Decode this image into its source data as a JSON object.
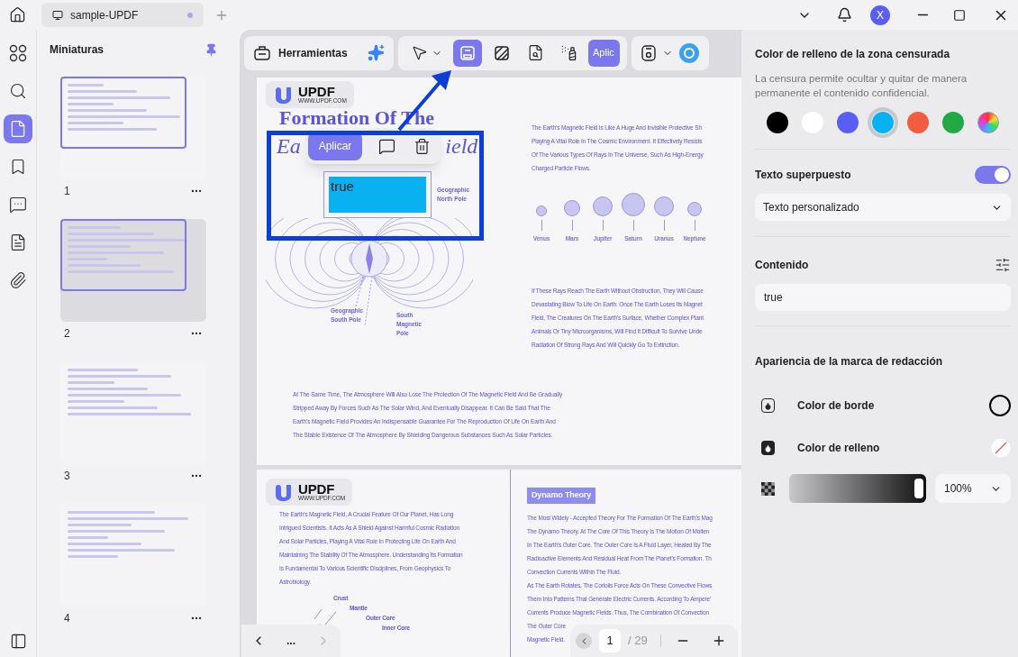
{
  "tab": {
    "title": "sample-UPDF"
  },
  "account": {
    "initial": "X"
  },
  "rail": [
    {
      "kind": "thumbnails-grid",
      "selected": false
    },
    {
      "kind": "search",
      "selected": false
    },
    {
      "kind": "pages",
      "selected": true
    },
    {
      "kind": "bookmark",
      "selected": false
    },
    {
      "kind": "comments",
      "selected": false
    },
    {
      "kind": "form",
      "selected": false
    },
    {
      "kind": "attachment",
      "selected": false
    }
  ],
  "thumbnails": {
    "title": "Miniaturas",
    "pages": [
      {
        "number": "1",
        "in_view": true
      },
      {
        "number": "2",
        "in_view": true
      },
      {
        "number": "3",
        "in_view": false
      },
      {
        "number": "4",
        "in_view": false
      }
    ]
  },
  "toolbar": {
    "tools_label": "Herramientas",
    "tools": [
      {
        "kind": "select",
        "selected": false
      },
      {
        "kind": "redact",
        "selected": true
      },
      {
        "kind": "hatch",
        "selected": false
      },
      {
        "kind": "find",
        "selected": false
      },
      {
        "kind": "spray",
        "selected": false
      }
    ],
    "apply_label": "Aplic"
  },
  "document": {
    "logo": "UPDF",
    "logo_url": "WWW.UPDF.COM",
    "title": "Formation Of The",
    "subtitle_start": "Ea",
    "subtitle_end": "ield",
    "popup": {
      "apply": "Aplicar"
    },
    "redaction": {
      "text": "true",
      "color": "#0ab1f0"
    },
    "field_labels": [
      "Geographic North Pole",
      "Geographic South Pole",
      "South Magnetic Pole"
    ],
    "paragraph_1": [
      "The Earth's Magnetic Field Is Like A Huge And Invisible Protective Sh",
      "Playing A Vital Role In The Cosmic Environment. It Effectively Resists",
      "Of The Various Types Of Rays In The Universe, Such As High-Energy",
      "Charged Particle Flows."
    ],
    "planets": [
      "Venus",
      "Mars",
      "Jupiter",
      "Saturn",
      "Uranus",
      "Neptune"
    ],
    "paragraph_2": [
      "If These Rays Reach The Earth Without Obstruction, They Will Cause",
      "Devastating Blow To Life On Earth. Once The Earth Loses Its Magnet",
      "Field, The Creatures On The Earth's Surface, Whether Complex Plant",
      "Animals Or Tiny Microorganisms, Will Find It Difficult To Survive Unde",
      "Radiation Of Strong Rays And Will Quickly Go To Extinction."
    ],
    "paragraph_3": [
      "At The Same Time, The Atmosphere Will Also Lose The Protection Of The Magnetic Field And Be Gradually",
      "Stripped Away By Forces Such As The Solar Wind, And Eventually Disappear. It Can Be Said That The",
      "Earth's Magnetic Field Provides An Indispensable Guarantee For The Reproduction Of Life On Earth And",
      "The Stable Existence Of The Atmosphere By Shielding Dangerous Substances Such As Solar Particles."
    ],
    "page_2": {
      "logo": "UPDF",
      "logo_url": "WWW.UPDF.COM",
      "left": [
        "The Earth's Magnetic Field, A Crucial Feature Of Our Planet, Has Long",
        "Intrigued Scientists. It Acts As A Shield Against Harmful Cosmic Radiation",
        "And Solar Particles, Playing A Vital Role In Protecting Life On Earth And",
        "Maintaining The Stability Of The Atmosphere. Understanding Its Formation",
        "Is Fundamental To Various Scientific Disciplines, From Geophysics To",
        "Astrobiology."
      ],
      "earth_labels": [
        "Crust",
        "Mantle",
        "Outer Core",
        "Inner Core"
      ],
      "heading": "Dynamo Theory",
      "right": [
        "The Most Widely - Accepted Theory For The Formation Of The Earth's Mag",
        "The Dynamo Theory. At The Core Of This Theory Is The Motion Of Molten",
        "In The Earth's Outer Core. The Outer Core Is A Fluid Layer, Heated By The",
        "Radioactive Elements And Residual Heat From The Planet's Formation. Th",
        "Convection Currents Within The Fluid.",
        "As The Earth Rotates, The Coriolis Force Acts On These Convective Flows",
        "Them Into Patterns That Generate Electric Currents. According To Ampere'",
        "Currents Produce Magnetic Fields. Thus, The Combination Of Convection",
        "The Outer Core",
        "Magnetic Field."
      ]
    }
  },
  "page_nav": {
    "more": "...",
    "page": "1",
    "total": "/ 29"
  },
  "panel": {
    "fill_title": "Color de relleno de la zona censurada",
    "fill_desc": "La censura permite ocultar y quitar de manera permanente el contenido confidencial.",
    "swatches": [
      {
        "kind": "solid",
        "color": "#000000",
        "selected": false
      },
      {
        "kind": "solid",
        "color": "#ffffff",
        "selected": false
      },
      {
        "kind": "solid",
        "color": "#5b5ef4",
        "selected": false
      },
      {
        "kind": "solid",
        "color": "#0ab1f0",
        "selected": true
      },
      {
        "kind": "solid",
        "color": "#f25c3f",
        "selected": false
      },
      {
        "kind": "solid",
        "color": "#22a845",
        "selected": false
      },
      {
        "kind": "gradient",
        "selected": false
      }
    ],
    "overlay_title": "Texto superpuesto",
    "overlay_on": true,
    "overlay_mode": "Texto personalizado",
    "content_title": "Contenido",
    "content_value": "true",
    "appearance_title": "Apariencia de la marca de redacción",
    "border_label": "Color de borde",
    "fill_label": "Color de relleno",
    "opacity": {
      "level": 1,
      "reading": "100%"
    }
  }
}
